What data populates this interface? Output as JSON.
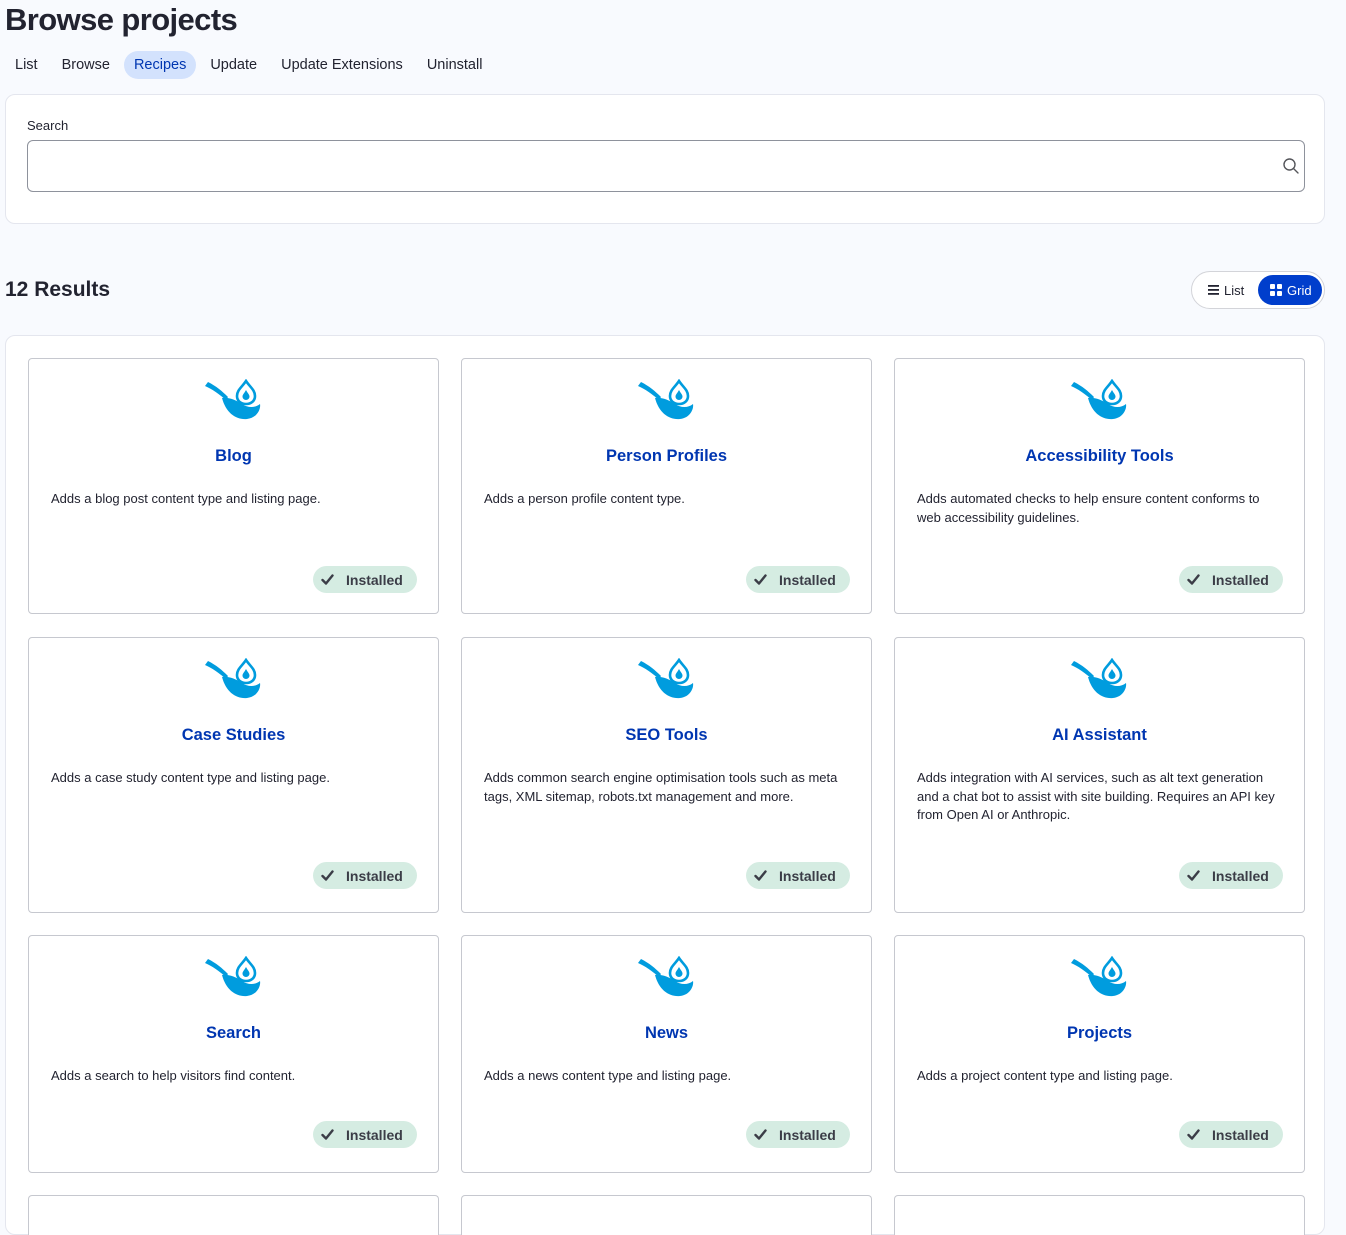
{
  "page": {
    "title": "Browse projects"
  },
  "tabs": [
    {
      "label": "List"
    },
    {
      "label": "Browse"
    },
    {
      "label": "Recipes",
      "active": true
    },
    {
      "label": "Update"
    },
    {
      "label": "Update Extensions"
    },
    {
      "label": "Uninstall"
    }
  ],
  "search": {
    "label": "Search",
    "value": "",
    "icon": "search-icon"
  },
  "results": {
    "count_text": "12 Results"
  },
  "view_toggle": {
    "list_label": "List",
    "grid_label": "Grid",
    "selected": "Grid"
  },
  "colors": {
    "accent": "#003ecc",
    "link": "#0036b1",
    "icon": "#009cde",
    "badge_bg": "#d5ece2"
  },
  "cards": [
    {
      "title": "Blog",
      "description": "Adds a blog post content type and listing page.",
      "status": "Installed",
      "icon": "recipe-pan-icon"
    },
    {
      "title": "Person Profiles",
      "description": "Adds a person profile content type.",
      "status": "Installed",
      "icon": "recipe-pan-icon"
    },
    {
      "title": "Accessibility Tools",
      "description": "Adds automated checks to help ensure content conforms to web accessibility guidelines.",
      "status": "Installed",
      "icon": "recipe-pan-icon"
    },
    {
      "title": "Case Studies",
      "description": "Adds a case study content type and listing page.",
      "status": "Installed",
      "icon": "recipe-pan-icon"
    },
    {
      "title": "SEO Tools",
      "description": "Adds common search engine optimisation tools such as meta tags, XML sitemap, robots.txt management and more.",
      "status": "Installed",
      "icon": "recipe-pan-icon"
    },
    {
      "title": "AI Assistant",
      "description": "Adds integration with AI services, such as alt text generation and a chat bot to assist with site building. Requires an API key from Open AI or Anthropic.",
      "status": "Installed",
      "icon": "recipe-pan-icon"
    },
    {
      "title": "Search",
      "description": "Adds a search to help visitors find content.",
      "status": "Installed",
      "icon": "recipe-pan-icon"
    },
    {
      "title": "News",
      "description": "Adds a news content type and listing page.",
      "status": "Installed",
      "icon": "recipe-pan-icon"
    },
    {
      "title": "Projects",
      "description": "Adds a project content type and listing page.",
      "status": "Installed",
      "icon": "recipe-pan-icon"
    }
  ]
}
